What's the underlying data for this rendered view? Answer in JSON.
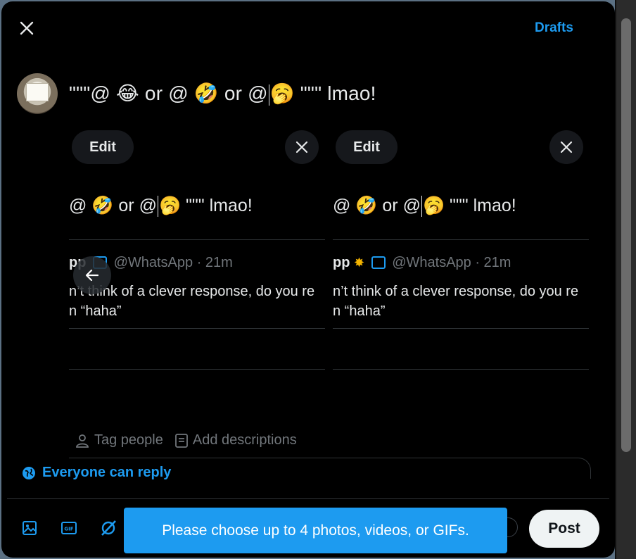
{
  "header": {
    "drafts_label": "Drafts"
  },
  "compose": {
    "text_before_caret": "\"\"\"@ 😂  or @ 🤣  or @",
    "text_after_caret": "🥱 \"\"\" lmao!"
  },
  "cards": [
    {
      "edit_label": "Edit",
      "text_before_caret": "@ 🤣  or @",
      "text_after_caret": "🥱 \"\"\" lmao!",
      "name": "pp",
      "handle": "@WhatsApp · 21m",
      "body_line1": "n’t think of a clever response, do you re",
      "body_line2": "n “haha”"
    },
    {
      "edit_label": "Edit",
      "text_before_caret": "@ 🤣  or @",
      "text_after_caret": "🥱 \"\"\" lmao!",
      "name": "pp",
      "handle": "@WhatsApp · 21m",
      "body_line1": "n’t think of a clever response, do you re",
      "body_line2": "n “haha”"
    }
  ],
  "media_actions": {
    "tag_people": "Tag people",
    "add_descriptions": "Add descriptions"
  },
  "reply_setting": "Everyone can reply",
  "toast": "Please choose up to 4 photos, videos, or GIFs.",
  "post_label": "Post",
  "toolbar_icons": [
    "image-icon",
    "gif-icon",
    "grok-icon"
  ],
  "colors": {
    "accent": "#1d9bf0",
    "background": "#000000",
    "text": "#e7e9ea",
    "muted": "#71767b"
  }
}
